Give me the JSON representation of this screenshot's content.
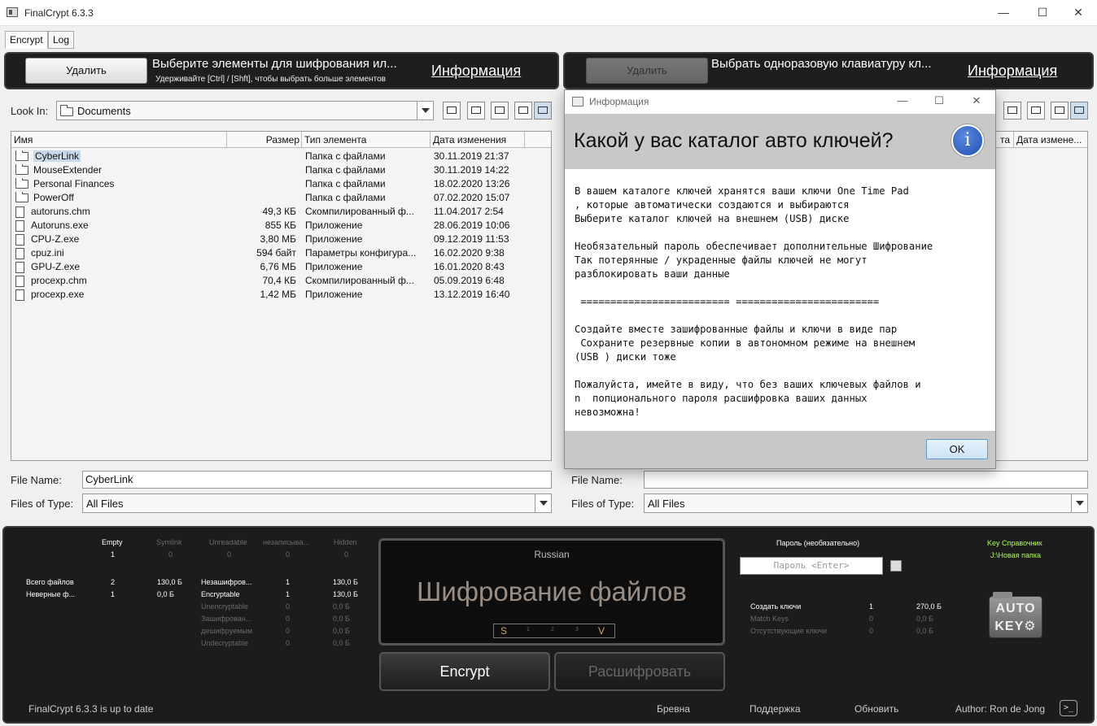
{
  "window": {
    "title": "FinalCrypt 6.3.3"
  },
  "tabs": [
    "Encrypt",
    "Log"
  ],
  "left_header": {
    "delete_label": "Удалить",
    "message": "Выберите элементы для шифрования ил...",
    "hint": "Удерживайте [Ctrl] / [Shft], чтобы выбрать больше элементов",
    "info_link": "Информация"
  },
  "right_header": {
    "delete_label": "Удалить",
    "message": "Выбрать одноразовую клавиатуру кл...",
    "info_link": "Информация"
  },
  "left_chooser": {
    "look_in_label": "Look In:",
    "look_in_value": "Documents",
    "columns": [
      "Имя",
      "Размер",
      "Тип элемента",
      "Дата изменения"
    ],
    "rows": [
      {
        "icon": "folder",
        "name": "CyberLink",
        "size": "",
        "type": "Папка с файлами",
        "date": "30.11.2019 21:37"
      },
      {
        "icon": "folder",
        "name": "MouseExtender",
        "size": "",
        "type": "Папка с файлами",
        "date": "30.11.2019 14:22"
      },
      {
        "icon": "folder",
        "name": "Personal Finances",
        "size": "",
        "type": "Папка с файлами",
        "date": "18.02.2020 13:26"
      },
      {
        "icon": "folder",
        "name": "PowerOff",
        "size": "",
        "type": "Папка с файлами",
        "date": "07.02.2020 15:07"
      },
      {
        "icon": "file",
        "name": "autoruns.chm",
        "size": "49,3 КБ",
        "type": "Скомпилированный ф...",
        "date": "11.04.2017 2:54"
      },
      {
        "icon": "file",
        "name": "Autoruns.exe",
        "size": "855 КБ",
        "type": "Приложение",
        "date": "28.06.2019 10:06"
      },
      {
        "icon": "file",
        "name": "CPU-Z.exe",
        "size": "3,80 МБ",
        "type": "Приложение",
        "date": "09.12.2019 11:53"
      },
      {
        "icon": "file",
        "name": "cpuz.ini",
        "size": "594 байт",
        "type": "Параметры конфигура...",
        "date": "16.02.2020 9:38"
      },
      {
        "icon": "file",
        "name": "GPU-Z.exe",
        "size": "6,76 МБ",
        "type": "Приложение",
        "date": "16.01.2020 8:43"
      },
      {
        "icon": "file",
        "name": "procexp.chm",
        "size": "70,4 КБ",
        "type": "Скомпилированный ф...",
        "date": "05.09.2019 6:48"
      },
      {
        "icon": "file",
        "name": "procexp.exe",
        "size": "1,42 МБ",
        "type": "Приложение",
        "date": "13.12.2019 16:40"
      }
    ],
    "file_name_label": "File Name:",
    "file_name_value": "CyberLink",
    "files_of_type_label": "Files of Type:",
    "files_of_type_value": "All Files"
  },
  "right_chooser": {
    "columns_visible": [
      "та",
      "Дата измене..."
    ],
    "file_name_label": "File Name:",
    "file_name_value": "",
    "files_of_type_label": "Files of Type:",
    "files_of_type_value": "All Files"
  },
  "dialog": {
    "title": "Информация",
    "question": "Какой у вас каталог авто ключей?",
    "body": "В вашем каталоге ключей хранятся ваши ключи One Time Pad\n, которые автоматически создаются и выбираются\nВыберите каталог ключей на внешнем (USB) диске\n\nНеобязательный пароль обеспечивает дополнительные Шифрование\nТак потерянные / украденные файлы ключей не могут\nразблокировать ваши данные\n\n ========================= ========================\n\nСоздайте вместе зашифрованные файлы и ключи в виде пар\n Сохраните резервные копии в автономном режиме на внешнем\n(USB ) диски тоже\n\nПожалуйста, имейте в виду, что без ваших ключевых файлов и\nn  попционального пароля расшифровка ваших данных\nневозможна!",
    "ok_label": "OK"
  },
  "stats": {
    "headers": [
      "Empty",
      "Symlink",
      "Unreadable",
      "незаписыва...",
      "Hidden"
    ],
    "header_values": [
      "1",
      "0",
      "0",
      "0",
      "0"
    ],
    "left_rows": [
      {
        "label": "Всего файлов",
        "count": "2",
        "size": "130,0 Б"
      },
      {
        "label": "Неверные ф...",
        "count": "1",
        "size": "0,0 Б"
      }
    ],
    "mid_rows": [
      {
        "label": "Незашифров...",
        "count": "1",
        "size": "130,0 Б",
        "active": true
      },
      {
        "label": "Encryptable",
        "count": "1",
        "size": "130,0 Б",
        "active": true
      },
      {
        "label": "Unencryptable",
        "count": "0",
        "size": "0,0 Б",
        "active": false
      },
      {
        "label": "Зашифрован...",
        "count": "0",
        "size": "0,0 Б",
        "active": false
      },
      {
        "label": "дешифруемым",
        "count": "0",
        "size": "0,0 Б",
        "active": false
      },
      {
        "label": "Undecryptable",
        "count": "0",
        "size": "0,0 Б",
        "active": false
      }
    ]
  },
  "center": {
    "language": "Russian",
    "big_text": "Шифрование файлов",
    "sv_left": "S",
    "sv_ticks": [
      "1",
      "2",
      "3"
    ],
    "sv_right": "V",
    "encrypt_label": "Encrypt",
    "decrypt_label": "Расшифровать"
  },
  "keys": {
    "password_label": "Пароль (необязательно)",
    "password_placeholder": "Пароль <Enter>",
    "key_dir_label": "Key Справочник",
    "key_dir_value": "J:\\Новая папка",
    "rows": [
      {
        "label": "Создать ключи",
        "count": "1",
        "size": "270,0 Б",
        "active": true
      },
      {
        "label": "Match Keys",
        "count": "0",
        "size": "0,0 Б",
        "active": false
      },
      {
        "label": "Отсутствующие ключи",
        "count": "0",
        "size": "0,0 Б",
        "active": false
      }
    ],
    "autokey_line1": "AUTO",
    "autokey_line2": "KEY⚙"
  },
  "footer": {
    "status": "FinalCrypt 6.3.3 is up to date",
    "links": [
      "Бревна",
      "Поддержка",
      "Обновить"
    ],
    "author": "Author: Ron de Jong",
    "terminal": ">_"
  }
}
